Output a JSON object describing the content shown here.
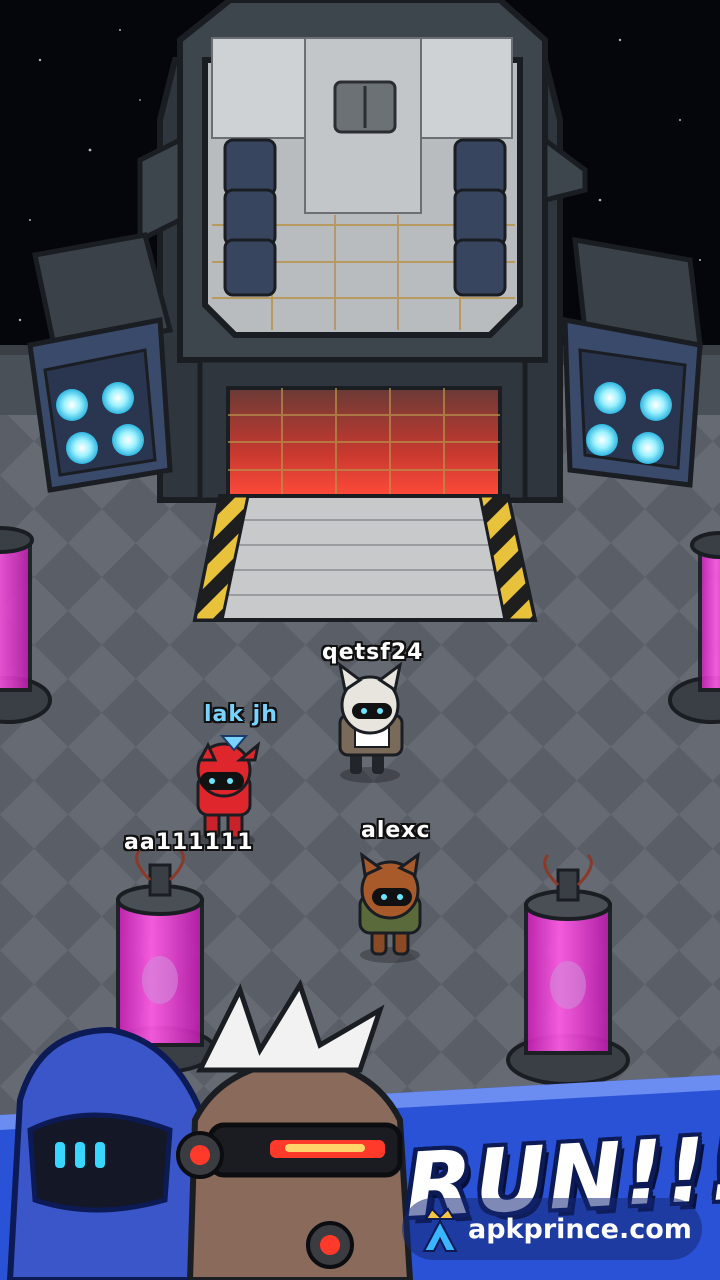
{
  "players": [
    {
      "id": "qetsf24",
      "name": "qetsf24",
      "is_self": false
    },
    {
      "id": "lakjh",
      "name": "lak jh",
      "is_self": true
    },
    {
      "id": "aa111111",
      "name": "aa111111",
      "is_self": false
    },
    {
      "id": "alexc",
      "name": "alexc",
      "is_self": false
    }
  ],
  "banner": {
    "text": "RUN!!!"
  },
  "watermark": {
    "text": "apkprince.com"
  },
  "colors": {
    "space": "#05060c",
    "floor_light": "#6b6f78",
    "floor_dark": "#5b5f68",
    "ship_hull": "#3a4148",
    "ship_door_glow": "#e0413a",
    "thruster_glow": "#7fe6ff",
    "capsule_liquid": "#ff3fd6",
    "banner_blue": "#2a52d6",
    "self_name": "#7ad3ff"
  }
}
